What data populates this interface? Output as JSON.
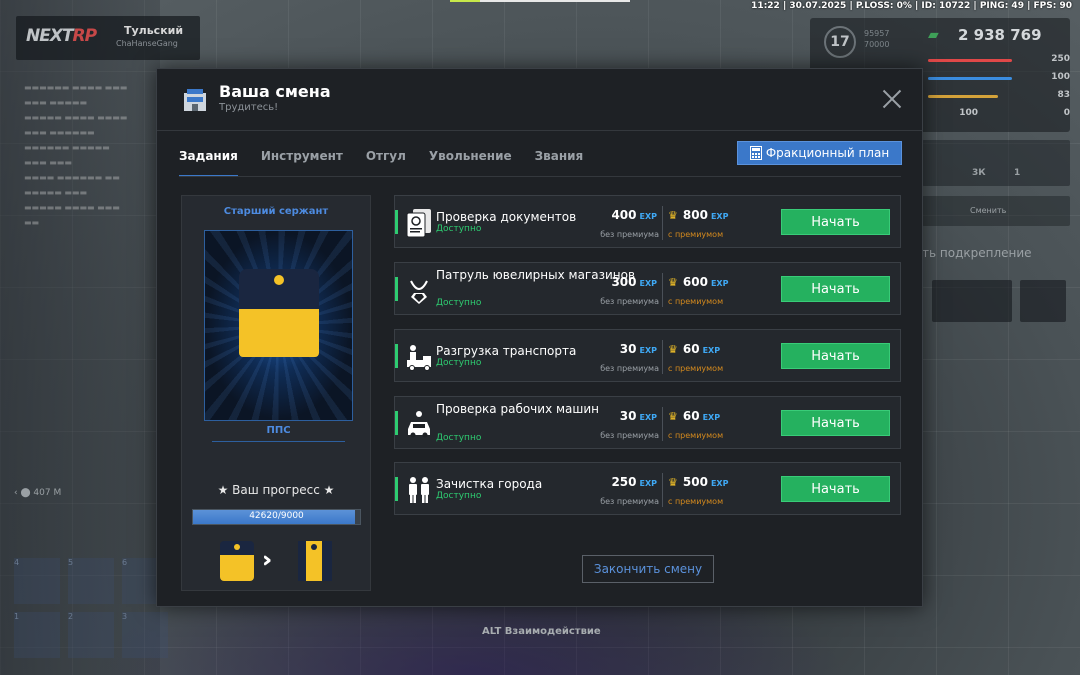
{
  "hud": {
    "status_line": "11:22 | 30.07.2025 | P.LOSS: 0% | ID: 10722 | PING: 49 | FPS: 90",
    "logo_main": "NEXT",
    "logo_accent": "RP",
    "server_name": "Тульский",
    "server_sub": "ChaHanseGang",
    "level": "17",
    "xp_current": "95957",
    "xp_max": "70000",
    "money": "2 938 769",
    "stats": [
      {
        "value": "250",
        "color": "#e04848"
      },
      {
        "value": "100",
        "color": "#3b8de0"
      },
      {
        "value": "83",
        "color": "#d4a23a"
      },
      {
        "value": "100",
        "color": "#8a9096"
      }
    ],
    "zero_stat": "0",
    "cash_3k": "3К",
    "cash_1": "1",
    "change_label": "Сменить",
    "reinforce_label": "ть подкрепление",
    "alt_hint": "ALT Взаимодействие",
    "distance": "407 М",
    "slots": [
      "4",
      "5",
      "6",
      "1",
      "2",
      "3"
    ]
  },
  "modal": {
    "title": "Ваша смена",
    "subtitle": "Трудитесь!",
    "tabs": [
      {
        "label": "Задания",
        "active": true
      },
      {
        "label": "Инструмент",
        "active": false
      },
      {
        "label": "Отгул",
        "active": false
      },
      {
        "label": "Увольнение",
        "active": false
      },
      {
        "label": "Звания",
        "active": false
      }
    ],
    "plan_button": "Фракционный план",
    "rank": {
      "name": "Старший сержант",
      "faction": "ППС",
      "progress_title": "★ Ваш прогресс ★",
      "progress_text": "42620/9000",
      "progress_fraction": 0.97
    },
    "exp_tag": "EXP",
    "base_label": "без премиума",
    "premium_label": "с премиумом",
    "start_label": "Начать",
    "tasks": [
      {
        "name": "Проверка документов",
        "status": "Доступно",
        "base": "400",
        "premium": "800",
        "icon": "documents-icon"
      },
      {
        "name": "Патруль ювелирных магазинов",
        "status": "Доступно",
        "base": "300",
        "premium": "600",
        "icon": "jewelry-icon"
      },
      {
        "name": "Разгрузка транспорта",
        "status": "Доступно",
        "base": "30",
        "premium": "60",
        "icon": "truck-icon"
      },
      {
        "name": "Проверка рабочих машин",
        "status": "Доступно",
        "base": "30",
        "premium": "60",
        "icon": "car-icon"
      },
      {
        "name": "Зачистка города",
        "status": "Доступно",
        "base": "250",
        "premium": "500",
        "icon": "people-icon"
      }
    ],
    "finish_button": "Закончить смену"
  }
}
